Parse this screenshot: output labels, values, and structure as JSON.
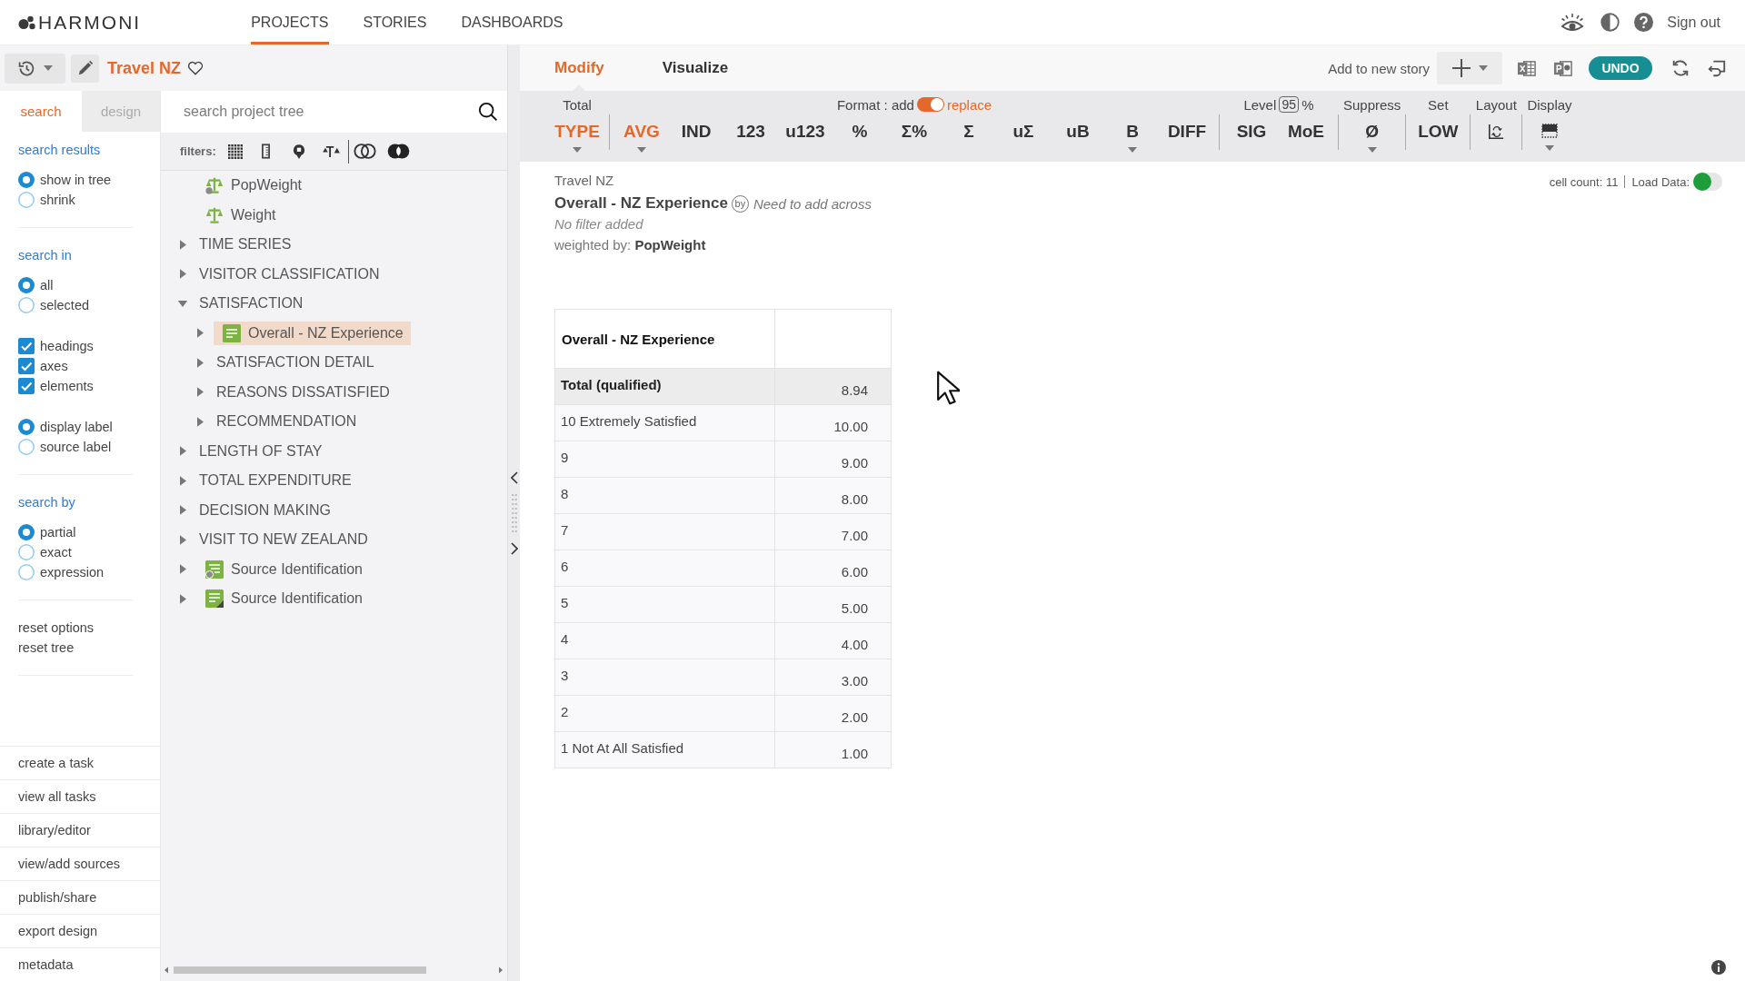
{
  "topbar": {
    "logo": "HARMONI",
    "nav": [
      {
        "label": "PROJECTS",
        "selected": true
      },
      {
        "label": "STORIES",
        "selected": false
      },
      {
        "label": "DASHBOARDS",
        "selected": false
      }
    ],
    "sign_out": "Sign out"
  },
  "project_bar": {
    "title": "Travel NZ",
    "favorite": false
  },
  "sidebar": {
    "tabs": [
      {
        "label": "search",
        "selected": true
      },
      {
        "label": "design",
        "selected": false
      }
    ],
    "sections": [
      {
        "heading": "search results",
        "groups": [
          [
            {
              "kind": "radio",
              "label": "show in tree",
              "selected": true
            },
            {
              "kind": "radio",
              "label": "shrink",
              "selected": false
            }
          ]
        ]
      },
      {
        "heading": "search in",
        "groups": [
          [
            {
              "kind": "radio",
              "label": "all",
              "selected": true
            },
            {
              "kind": "radio",
              "label": "selected",
              "selected": false
            }
          ],
          [
            {
              "kind": "checkbox",
              "label": "headings",
              "checked": true
            },
            {
              "kind": "checkbox",
              "label": "axes",
              "checked": true
            },
            {
              "kind": "checkbox",
              "label": "elements",
              "checked": true
            }
          ],
          [
            {
              "kind": "radio",
              "label": "display label",
              "selected": true
            },
            {
              "kind": "radio",
              "label": "source label",
              "selected": false
            }
          ]
        ]
      },
      {
        "heading": "search by",
        "groups": [
          [
            {
              "kind": "radio",
              "label": "partial",
              "selected": true
            },
            {
              "kind": "radio",
              "label": "exact",
              "selected": false
            },
            {
              "kind": "radio",
              "label": "expression",
              "selected": false
            }
          ]
        ]
      },
      {
        "links": [
          "reset options",
          "reset tree"
        ]
      }
    ],
    "actions": [
      "create a task",
      "view all tasks",
      "library/editor",
      "view/add sources",
      "publish/share",
      "export design",
      "metadata"
    ]
  },
  "tree_panel": {
    "search": {
      "placeholder": "search project tree"
    },
    "filters_label": "filters:",
    "items": [
      {
        "kind": "derivedweight",
        "label": "PopWeight",
        "selected": false
      },
      {
        "kind": "weight",
        "label": "Weight",
        "selected": false
      },
      {
        "kind": "folder",
        "label": "TIME SERIES",
        "expanded": false,
        "selected": false
      },
      {
        "kind": "folder",
        "label": "VISITOR CLASSIFICATION",
        "expanded": false,
        "selected": false
      },
      {
        "kind": "folder",
        "label": "SATISFACTION",
        "expanded": true,
        "selected": false,
        "children": [
          {
            "kind": "variable",
            "label": "Overall - NZ Experience",
            "expanded": false,
            "selected": true
          },
          {
            "kind": "folder",
            "label": "SATISFACTION DETAIL",
            "expanded": false,
            "selected": false
          },
          {
            "kind": "folder",
            "label": "REASONS DISSATISFIED",
            "expanded": false,
            "selected": false
          },
          {
            "kind": "folder",
            "label": "RECOMMENDATION",
            "expanded": false,
            "selected": false
          }
        ]
      },
      {
        "kind": "folder",
        "label": "LENGTH OF STAY",
        "expanded": false,
        "selected": false
      },
      {
        "kind": "folder",
        "label": "TOTAL EXPENDITURE",
        "expanded": false,
        "selected": false
      },
      {
        "kind": "folder",
        "label": "DECISION MAKING",
        "expanded": false,
        "selected": false
      },
      {
        "kind": "folder",
        "label": "VISIT TO NEW ZEALAND",
        "expanded": false,
        "selected": false
      },
      {
        "kind": "derivedvariable",
        "label": "Source Identification",
        "expanded": false,
        "selected": false
      },
      {
        "kind": "editedvariable",
        "label": "Source Identification",
        "expanded": false,
        "selected": false
      }
    ]
  },
  "workspace": {
    "views": [
      {
        "label": "Modify",
        "selected": true
      },
      {
        "label": "Visualize",
        "selected": false
      }
    ],
    "add_to_story": "Add to new story",
    "undo": "UNDO",
    "toolbar": {
      "groups": [
        {
          "kind": "label",
          "label": "Total",
          "buttons": [
            {
              "kind": "text",
              "label": "TYPE",
              "selected": true,
              "dropdown": true
            }
          ]
        },
        {
          "kind": "format",
          "label": "Format : add",
          "option": "replace",
          "on": true,
          "buttons": [
            {
              "kind": "text",
              "label": "AVG",
              "selected": true,
              "dropdown": true
            },
            {
              "kind": "text",
              "label": "IND",
              "selected": false,
              "dropdown": false
            },
            {
              "kind": "text",
              "label": "123",
              "selected": false,
              "dropdown": false
            },
            {
              "kind": "text",
              "label": "u123",
              "selected": false,
              "dropdown": false
            },
            {
              "kind": "text",
              "label": "%",
              "selected": false,
              "dropdown": false
            },
            {
              "kind": "text",
              "label": "Σ%",
              "selected": false,
              "dropdown": false
            },
            {
              "kind": "text",
              "label": "Σ",
              "selected": false,
              "dropdown": false
            },
            {
              "kind": "text",
              "label": "uΣ",
              "selected": false,
              "dropdown": false
            },
            {
              "kind": "text",
              "label": "uB",
              "selected": false,
              "dropdown": false
            },
            {
              "kind": "text",
              "label": "B",
              "selected": false,
              "dropdown": true
            },
            {
              "kind": "text",
              "label": "DIFF",
              "selected": false,
              "dropdown": false
            }
          ]
        },
        {
          "kind": "level",
          "label": "Level",
          "value": "95",
          "unit": "%",
          "buttons": [
            {
              "kind": "text",
              "label": "SIG",
              "selected": false,
              "dropdown": false
            },
            {
              "kind": "text",
              "label": "MoE",
              "selected": false,
              "dropdown": false
            }
          ]
        },
        {
          "kind": "label",
          "label": "Suppress",
          "buttons": [
            {
              "kind": "text",
              "label": "Ø",
              "selected": false,
              "dropdown": true
            }
          ]
        },
        {
          "kind": "label",
          "label": "Set",
          "buttons": [
            {
              "kind": "text",
              "label": "LOW",
              "selected": false,
              "dropdown": false
            }
          ]
        },
        {
          "kind": "label",
          "label": "Layout",
          "buttons": [
            {
              "kind": "layout",
              "selected": false,
              "dropdown": false
            }
          ]
        },
        {
          "kind": "label",
          "label": "Display",
          "buttons": [
            {
              "kind": "display",
              "selected": false,
              "dropdown": true
            }
          ]
        }
      ]
    }
  },
  "report": {
    "project": "Travel NZ",
    "title": "Overall - NZ Experience",
    "across_button": "by",
    "across": "Need to add across",
    "filter": "No filter added",
    "weighting": "weighted by: **PopWeight**",
    "cell_count": "cell count: 11",
    "load_data": {
      "label": "Load Data:",
      "on": false
    }
  },
  "table": {
    "header": "Overall - NZ Experience",
    "rows": [
      {
        "kind": "total",
        "label": "Total (qualified)",
        "value": "8.94"
      },
      {
        "kind": "category",
        "label": "10 Extremely Satisfied",
        "value": "10.00"
      },
      {
        "kind": "category",
        "label": "9",
        "value": "9.00"
      },
      {
        "kind": "category",
        "label": "8",
        "value": "8.00"
      },
      {
        "kind": "category",
        "label": "7",
        "value": "7.00"
      },
      {
        "kind": "category",
        "label": "6",
        "value": "6.00"
      },
      {
        "kind": "category",
        "label": "5",
        "value": "5.00"
      },
      {
        "kind": "category",
        "label": "4",
        "value": "4.00"
      },
      {
        "kind": "category",
        "label": "3",
        "value": "3.00"
      },
      {
        "kind": "category",
        "label": "2",
        "value": "2.00"
      },
      {
        "kind": "category",
        "label": "1 Not At All Satisfied",
        "value": "1.00"
      }
    ]
  }
}
